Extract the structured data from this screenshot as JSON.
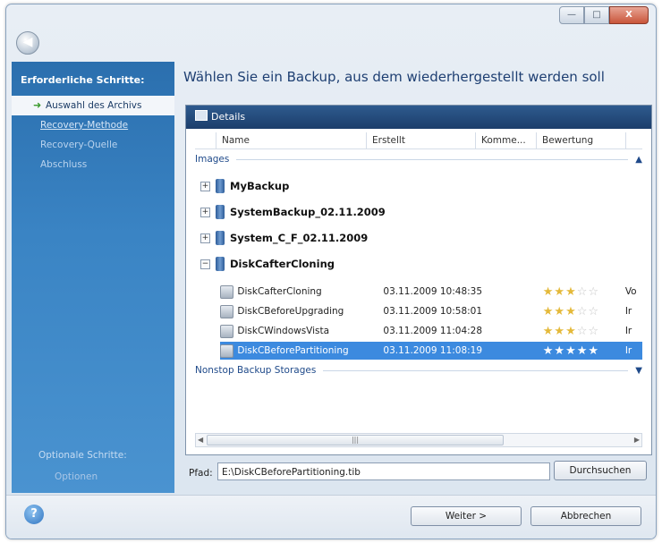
{
  "window": {
    "caption_min": "—",
    "caption_max": "□",
    "caption_close": "X"
  },
  "sidebar": {
    "header": "Erforderliche Schritte:",
    "items": [
      {
        "label": "Auswahl des Archivs",
        "state": "active"
      },
      {
        "label": "Recovery-Methode",
        "state": "link"
      },
      {
        "label": "Recovery-Quelle",
        "state": "disabled"
      },
      {
        "label": "Abschluss",
        "state": "disabled"
      }
    ],
    "optional_header": "Optionale Schritte:",
    "optional_item": "Optionen"
  },
  "main": {
    "heading": "Wählen Sie ein Backup, aus dem wiederhergestellt werden soll"
  },
  "details": {
    "title": "Details",
    "columns": [
      "Name",
      "Erstellt",
      "Komme...",
      "Bewertung"
    ],
    "group_images": "Images",
    "group_nonstop": "Nonstop Backup Storages",
    "backups": [
      {
        "name": "MyBackup",
        "expander": "+"
      },
      {
        "name": "SystemBackup_02.11.2009",
        "expander": "+"
      },
      {
        "name": "System_C_F_02.11.2009",
        "expander": "+"
      },
      {
        "name": "DiskCafterCloning",
        "expander": "−"
      }
    ],
    "versions": [
      {
        "name": "DiskCafterCloning",
        "created": "03.11.2009 10:48:35",
        "rating": 3,
        "comment": "Vo"
      },
      {
        "name": "DiskCBeforeUpgrading",
        "created": "03.11.2009 10:58:01",
        "rating": 3,
        "comment": "Ir"
      },
      {
        "name": "DiskCWindowsVista",
        "created": "03.11.2009 11:04:28",
        "rating": 3,
        "comment": "Ir"
      },
      {
        "name": "DiskCBeforePartitioning",
        "created": "03.11.2009 11:08:19",
        "rating": 5,
        "comment": "Ir",
        "selected": true
      }
    ]
  },
  "path": {
    "label": "Pfad:",
    "value": "E:\\DiskCBeforePartitioning.tib",
    "browse_label": "Durchsuchen"
  },
  "footer": {
    "next_label": "Weiter >",
    "cancel_label": "Abbrechen",
    "help_glyph": "?"
  }
}
